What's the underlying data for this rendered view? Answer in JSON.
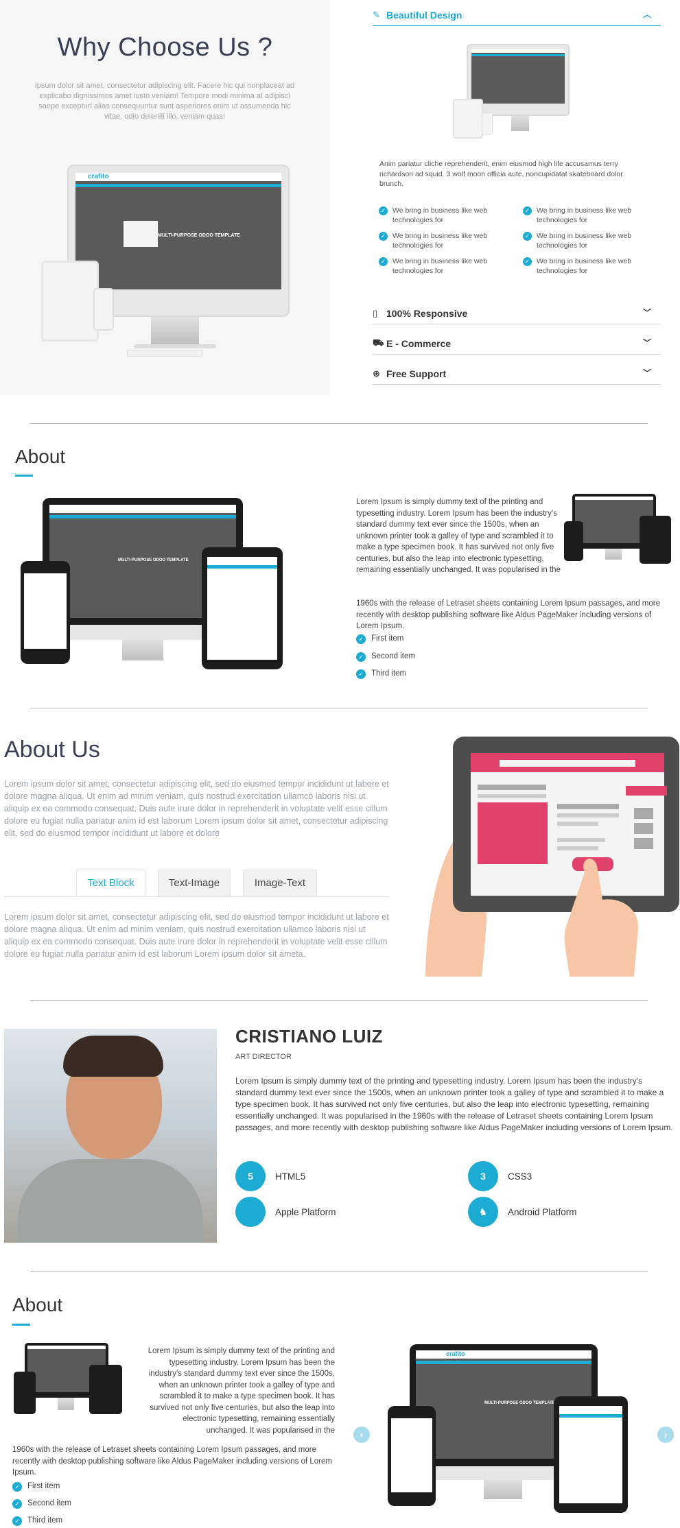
{
  "why": {
    "title": "Why Choose Us ?",
    "text": "Ipsum dolor sit amet, consectetur adipiscing elit. Facere hic qui nonplaceat ad explicabo dignissimos amet iusto veniam! Tempore modi minima at adipisci saepe excepturi alias consequuntur sunt asperiores enim ut assumenda hic vitae, odio deleniti illo, veniam quas!",
    "logo": "crafito",
    "screen_caption": "MULTI-PURPOSE ODOO TEMPLATE"
  },
  "accordion": {
    "items": [
      {
        "label": "Beautiful Design",
        "icon": "brush-icon"
      },
      {
        "label": "100% Responsive",
        "icon": "mobile-icon"
      },
      {
        "label": "E - Commerce",
        "icon": "cart-icon"
      },
      {
        "label": "Free Support",
        "icon": "lifebuoy-icon"
      }
    ],
    "paragraph": "Anim pariatur cliche reprehenderit, enim eiusmod high life accusamus terry richardson ad squid. 3 wolf moon officia aute, noncupidatat skateboard dolor brunch.",
    "checks": [
      "We bring in business like web technologies for",
      "We bring in business like web technologies for",
      "We bring in business like web technologies for",
      "We bring in business like web technologies for",
      "We bring in business like web technologies for",
      "We bring in business like web technologies for"
    ]
  },
  "about1": {
    "title": "About",
    "paragraph": "Lorem Ipsum is simply dummy text of the printing and typesetting industry. Lorem Ipsum has been the industry's standard dummy text ever since the 1500s, when an unknown printer took a galley of type and scrambled it to make a type specimen book. It has survived not only five centuries, but also the leap into electronic typesetting, remaining essentially unchanged. It was popularised in the 1960s with the release of Letraset sheets containing Lorem Ipsum passages, and more recently with desktop publishing software like Aldus PageMaker including versions of Lorem Ipsum.",
    "list": [
      "First item",
      "Second item",
      "Third item"
    ]
  },
  "aboutus": {
    "title": "About Us",
    "intro": "Lorem ipsum dolor sit amet, consectetur adipiscing elit, sed do eiusmod tempor incididunt ut labore et dolore magna aliqua. Ut enim ad minim veniam, quis nostrud exercitation ullamco laboris nisi ut aliquip ex ea commodo consequat. Duis aute irure dolor in reprehenderit in voluptate velit esse cillum dolore eu fugiat nulla pariatur anim id est laborum Lorem ipsum dolor sit amet, consectetur adipiscing elit, sed do eiusmod tempor incididunt ut labore et dolore",
    "tabs": [
      "Text Block",
      "Text-Image",
      "Image-Text"
    ],
    "tab_text": "Lorem ipsum dolor sit amet, consectetur adipiscing elit, sed do eiusmod tempor incididunt ut labore et dolore magna aliqua. Ut enim ad minim veniam, quis nostrud exercitation ullamco laboris nisi ut aliquip ex ea commodo consequat. Duis aute irure dolor in reprehenderit in voluptate velit esse cillum dolore eu fugiat nulla pariatur anim id est laborum Lorem ipsum dolor sit ameta."
  },
  "profile": {
    "name": "CRISTIANO LUIZ",
    "role": "ART DIRECTOR",
    "bio": "Lorem Ipsum is simply dummy text of the printing and typesetting industry. Lorem Ipsum has been the industry's standard dummy text ever since the 1500s, when an unknown printer took a galley of type and scrambled it to make a type specimen book. It has survived not only five centuries, but also the leap into electronic typesetting, remaining essentially unchanged. It was popularised in the 1960s with the release of Letraset sheets containing Lorem Ipsum passages, and more recently with desktop publishing software like Aldus PageMaker including versions of Lorem Ipsum.",
    "skills": [
      {
        "label": "HTML5",
        "icon": "html5-icon"
      },
      {
        "label": "CSS3",
        "icon": "css3-icon"
      },
      {
        "label": "Apple Platform",
        "icon": "apple-icon"
      },
      {
        "label": "Android Platform",
        "icon": "android-icon"
      }
    ]
  },
  "about2": {
    "title": "About",
    "paragraph": "Lorem Ipsum is simply dummy text of the printing and typesetting industry. Lorem Ipsum has been the industry's standard dummy text ever since the 1500s, when an unknown printer took a galley of type and scrambled it to make a type specimen book. It has survived not only five centuries, but also the leap into electronic typesetting, remaining essentially unchanged. It was popularised in the 1960s with the release of Letraset sheets containing Lorem Ipsum passages, and more recently with desktop publishing software like Aldus PageMaker including versions of Lorem Ipsum.",
    "list": [
      "First item",
      "Second item",
      "Third item"
    ]
  },
  "colors": {
    "accent": "#1cabd3",
    "tablet_pink": "#e0416a"
  }
}
